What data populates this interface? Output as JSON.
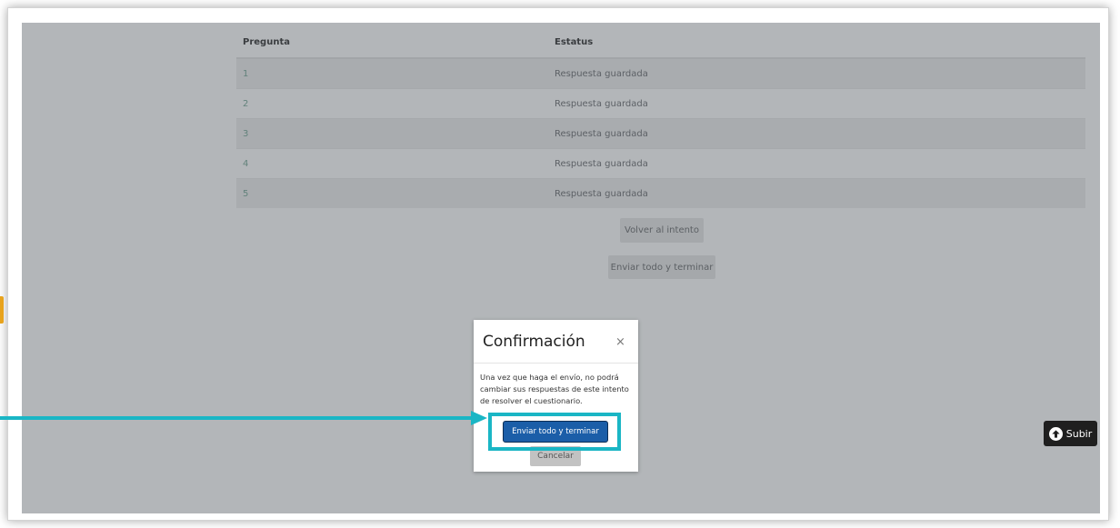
{
  "table": {
    "headers": {
      "question": "Pregunta",
      "status": "Estatus"
    },
    "rows": [
      {
        "question": "1",
        "status": "Respuesta guardada"
      },
      {
        "question": "2",
        "status": "Respuesta guardada"
      },
      {
        "question": "3",
        "status": "Respuesta guardada"
      },
      {
        "question": "4",
        "status": "Respuesta guardada"
      },
      {
        "question": "5",
        "status": "Respuesta guardada"
      }
    ]
  },
  "actions": {
    "return_label": "Volver al intento",
    "submit_label": "Enviar todo y terminar"
  },
  "modal": {
    "title": "Confirmación",
    "close_glyph": "×",
    "body": "Una vez que haga el envío, no podrá cambiar sus respuestas de este intento de resolver el cuestionario.",
    "confirm_label": "Enviar todo y terminar",
    "cancel_label": "Cancelar"
  },
  "scroll_top": {
    "label": "Subir",
    "icon": "arrow-up-circle-icon"
  },
  "colors": {
    "highlight": "#1ab6c5",
    "primary": "#1b5ea8",
    "backdrop": "#b3b6b9"
  }
}
